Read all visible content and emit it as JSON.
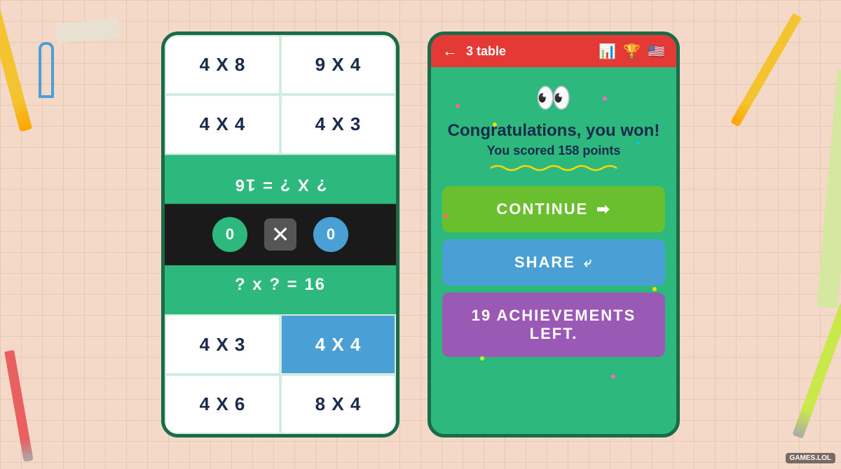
{
  "background": {
    "color": "#f5d9c8"
  },
  "left_card": {
    "cells": [
      {
        "id": "r0c0",
        "text": "4 X 8",
        "type": "normal"
      },
      {
        "id": "r0c1",
        "text": "9 X 4",
        "type": "normal"
      },
      {
        "id": "r1c0",
        "text": "4 X 4",
        "type": "normal"
      },
      {
        "id": "r1c1",
        "text": "4 X 3",
        "type": "normal"
      },
      {
        "id": "q1",
        "text": "? X ? = 16",
        "type": "question_mirrored"
      },
      {
        "id": "score",
        "type": "score"
      },
      {
        "id": "q2",
        "text": "? x ? = 16",
        "type": "question"
      },
      {
        "id": "r3c0",
        "text": "4 X 3",
        "type": "normal"
      },
      {
        "id": "r3c1",
        "text": "4 X 4",
        "type": "blue"
      },
      {
        "id": "r4c0",
        "text": "4 X 6",
        "type": "normal"
      },
      {
        "id": "r4c1",
        "text": "8 X 4",
        "type": "normal"
      }
    ],
    "score_left": "0",
    "score_right": "0"
  },
  "right_card": {
    "header": {
      "back_label": "←",
      "title": "3 table",
      "icon_chart": "📊",
      "icon_trophy": "🏆",
      "icon_flag": "🇺🇸"
    },
    "eyes": "👀",
    "congratulations": "Congratulations, you won!",
    "score_message": "You scored 158 points",
    "buttons": {
      "continue": "CONTINUE",
      "continue_icon": "➡",
      "share": "SHARE",
      "share_icon": "⬡",
      "achievements": "19 ACHIEVEMENTS LEFT."
    }
  },
  "badge": "GAMES.LOL"
}
